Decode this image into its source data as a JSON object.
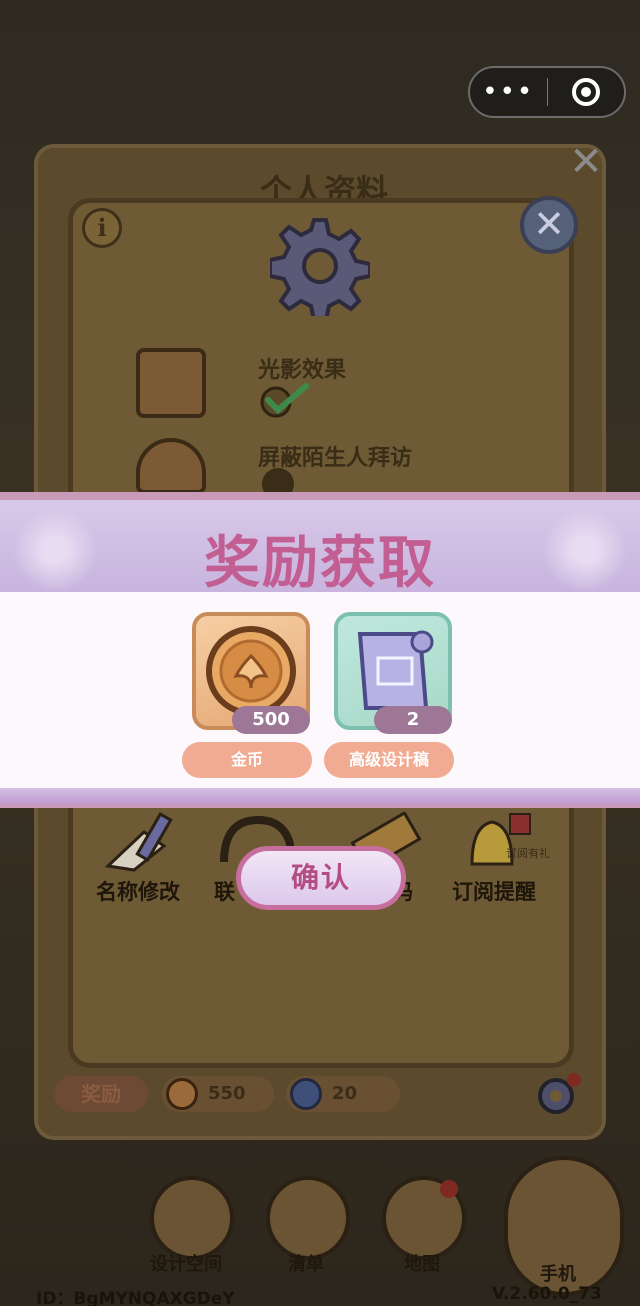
{
  "capsule": {
    "more_label": "•••",
    "target_icon": "target-icon"
  },
  "profile": {
    "title": "个人资料"
  },
  "settings": {
    "light_label": "光影效果",
    "block_label": "屏蔽陌生人拜访"
  },
  "reward_popup": {
    "title": "奖励获取",
    "items": [
      {
        "name": "金币",
        "count": "500",
        "icon": "coin-icon"
      },
      {
        "name": "高级设计稿",
        "count": "2",
        "icon": "blueprint-scroll-icon"
      }
    ],
    "confirm_label": "确认"
  },
  "functions": {
    "rename_label": "名称修改",
    "contact_label": "联",
    "code_label": "码",
    "subscribe_label": "订阅提醒",
    "gift_tag": "订阅有礼"
  },
  "panel_bottom": {
    "reward_tab": "奖励",
    "coins": "550",
    "gems": "20"
  },
  "nav": {
    "design_label": "设计空间",
    "list_label": "清单",
    "map_label": "地图",
    "phone_label": "手机"
  },
  "footer": {
    "id_text": "ID：BgMYNQAXGDeY",
    "version_text": "V.2.60.0_73"
  },
  "colors": {
    "title_pink": "#c25e92",
    "pill_orange": "#f1ab92",
    "count_mauve": "#9e7696"
  }
}
